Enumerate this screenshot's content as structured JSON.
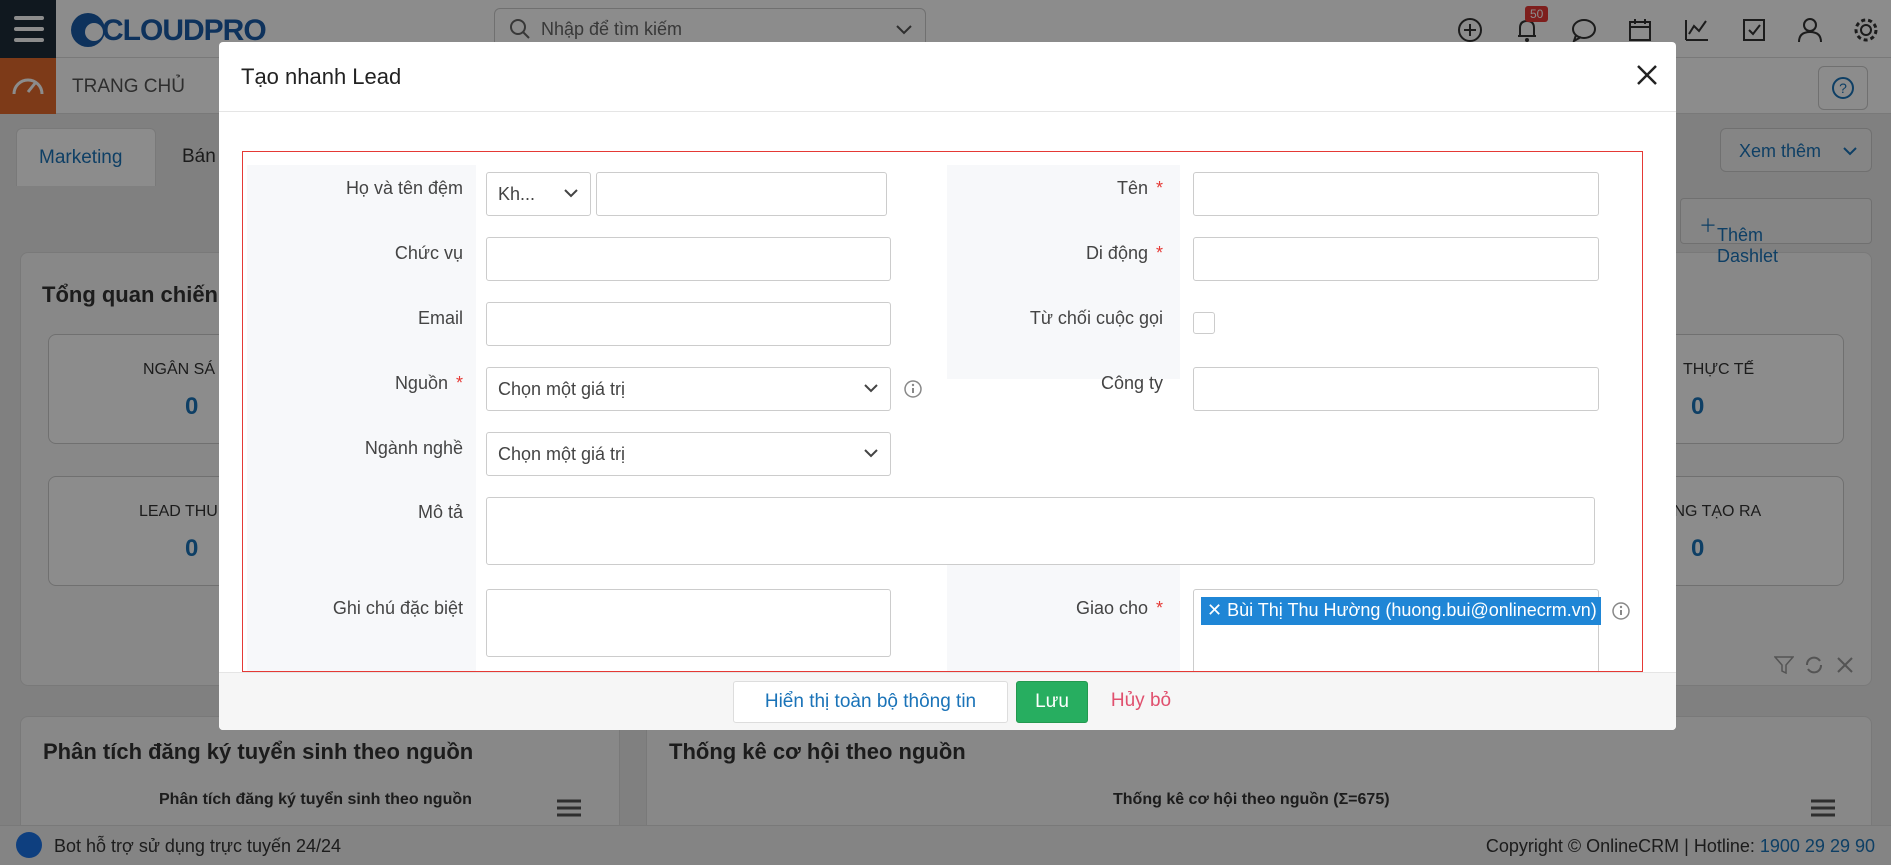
{
  "app": {
    "logo_text": "CLOUDPRO",
    "search_placeholder": "Nhập để tìm kiếm",
    "notification_count": "50",
    "home_label": "TRANG CHỦ",
    "tabs": [
      "Marketing",
      "Bán"
    ],
    "more_label": "Xem thêm",
    "add_dashlet_label": "Thêm Dashlet"
  },
  "dashboard": {
    "overview_title": "Tổng quan chiến",
    "cards": [
      {
        "label": "NGÂN SÁ",
        "value": "0"
      },
      {
        "label": "THỰC TẾ",
        "value": "0"
      },
      {
        "label": "LEAD THU",
        "value": "0"
      },
      {
        "label": "ỔNG TẠO RA",
        "value": "0"
      }
    ],
    "panel_left_title": "Phân tích đăng ký tuyển sinh theo nguồn",
    "panel_left_subtitle": "Phân tích đăng ký tuyển sinh theo nguồn",
    "panel_right_title": "Thống kê cơ hội theo nguồn",
    "panel_right_subtitle": "Thống kê cơ hội theo nguồn (Σ=675)"
  },
  "footer": {
    "bot_text": "Bot hỗ trợ sử dụng trực tuyến 24/24",
    "copyright": "Copyright © OnlineCRM | Hotline: ",
    "hotline": "1900 29 29 90"
  },
  "modal": {
    "title": "Tạo nhanh Lead",
    "fields": {
      "ho_ten_dem": {
        "label": "Họ và tên đệm",
        "salutation": "Kh...",
        "value": ""
      },
      "ten": {
        "label": "Tên",
        "required": "*",
        "value": ""
      },
      "chuc_vu": {
        "label": "Chức vụ",
        "value": ""
      },
      "di_dong": {
        "label": "Di động",
        "required": "*",
        "value": ""
      },
      "email": {
        "label": "Email",
        "value": ""
      },
      "tu_choi": {
        "label": "Từ chối cuộc gọi",
        "checked": false
      },
      "nguon": {
        "label": "Nguồn",
        "required": "*",
        "value": "Chọn một giá trị"
      },
      "cong_ty": {
        "label": "Công ty",
        "value": ""
      },
      "nganh_nghe": {
        "label": "Ngành nghề",
        "value": "Chọn một giá trị"
      },
      "mo_ta": {
        "label": "Mô tả",
        "value": ""
      },
      "ghi_chu": {
        "label": "Ghi chú đặc biệt",
        "value": ""
      },
      "giao_cho": {
        "label": "Giao cho",
        "required": "*",
        "tag": "Bùi Thị Thu Hường (huong.bui@onlinecrm.vn)"
      }
    },
    "buttons": {
      "show_all": "Hiển thị toàn bộ thông tin",
      "save": "Lưu",
      "cancel": "Hủy bỏ"
    }
  }
}
